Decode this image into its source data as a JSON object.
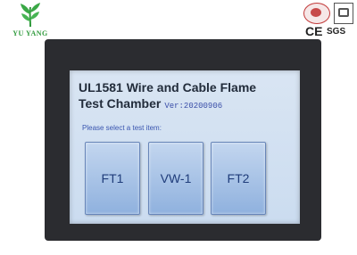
{
  "brand": {
    "logo_text": "YU YANG",
    "logo_color": "#2f9a3c"
  },
  "certifications": {
    "ce_mark": "CE",
    "sgs_mark": "SGS"
  },
  "screen": {
    "title_line1": "UL1581 Wire and Cable Flame",
    "title_line2": "Test Chamber",
    "version": "Ver:20200906",
    "prompt": "Please select a test item:",
    "test_items": [
      {
        "label": "FT1"
      },
      {
        "label": "VW-1"
      },
      {
        "label": "FT2"
      }
    ]
  }
}
